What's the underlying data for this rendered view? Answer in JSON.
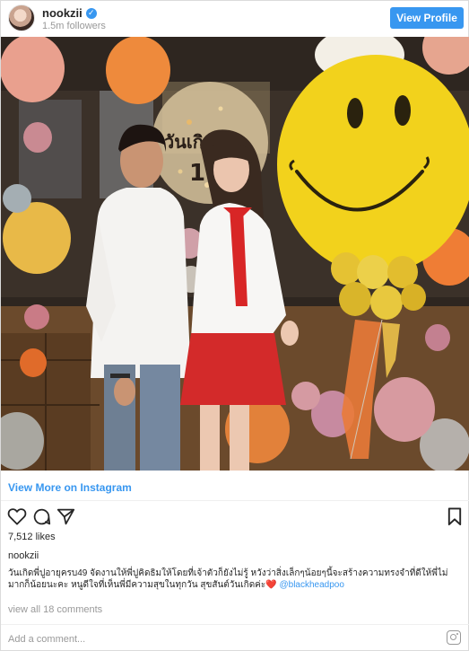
{
  "header": {
    "username": "nookzii",
    "followers": "1.5m followers",
    "view_profile_label": "View Profile"
  },
  "photo": {
    "balloon_text": "วันเกิ",
    "balloon_number": "19"
  },
  "view_more_label": "View More on Instagram",
  "actions": {
    "like_icon": "heart-icon",
    "comment_icon": "comment-icon",
    "share_icon": "share-icon",
    "save_icon": "bookmark-icon"
  },
  "likes": "7,512 likes",
  "caption": {
    "username": "nookzii",
    "text": "วันเกิดพี่ปูอายุครบ49 จัดงานให้พี่ปูคิดธิมให้โดยที่เจ้าตัวก็ยังไม่รู้ หวังว่าสิ่งเล็กๆน้อยๆนี้จะสร้างความทรงจำที่ดีให้พี่ไม่มากก็น้อยนะคะ หนูดีใจที่เห็นพี่มีความสุขในทุกวัน สุขสันต์วันเกิดค่ะ",
    "heart": "❤️",
    "mention": "@blackheadpoo"
  },
  "comments_link": "view all 18 comments",
  "add_comment_placeholder": "Add a comment...",
  "colors": {
    "accent": "#3897f0",
    "muted": "#999999",
    "text": "#262626"
  }
}
